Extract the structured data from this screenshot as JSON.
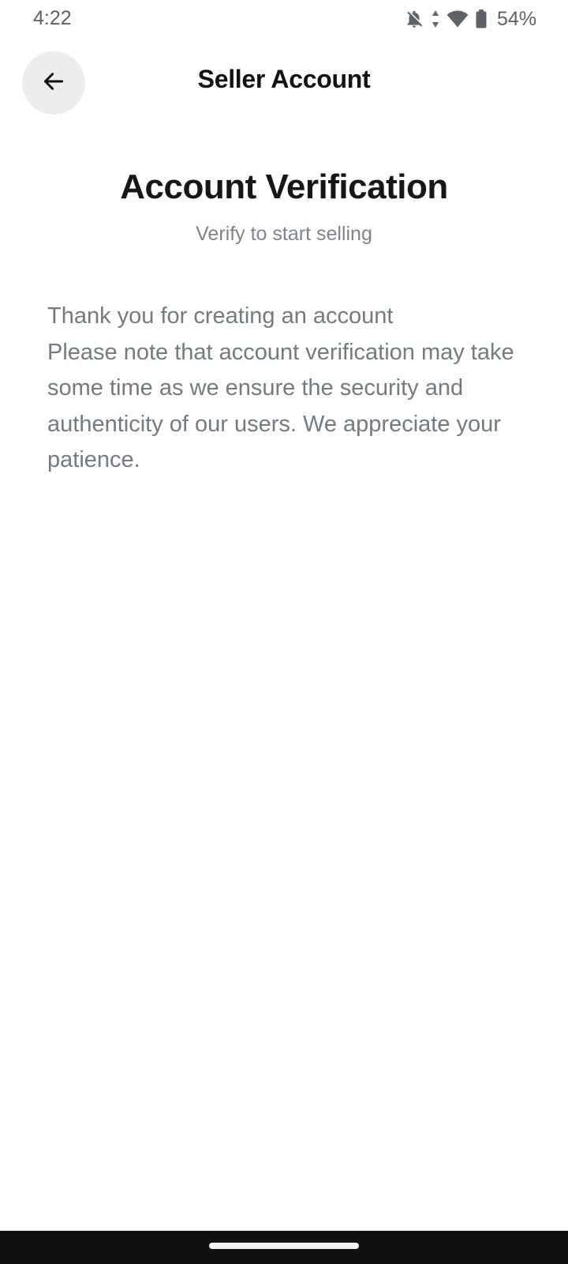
{
  "status_bar": {
    "time": "4:22",
    "battery_percent": "54%",
    "icons": [
      "notifications-off-icon",
      "data-arrows-icon",
      "wifi-icon",
      "battery-icon"
    ]
  },
  "header": {
    "title": "Seller Account",
    "back_icon": "arrow-left-icon"
  },
  "content": {
    "title": "Account Verification",
    "subtitle": "Verify to start selling",
    "message_line_1": "Thank you for creating an account",
    "message_line_2": "Please note that account verification may take some time as we ensure the security and authenticity of our users. We appreciate your patience."
  },
  "colors": {
    "background": "#ffffff",
    "title": "#161616",
    "muted_text": "#737a81",
    "back_button_bg": "#eceeee",
    "nav_bar": "#111111"
  }
}
